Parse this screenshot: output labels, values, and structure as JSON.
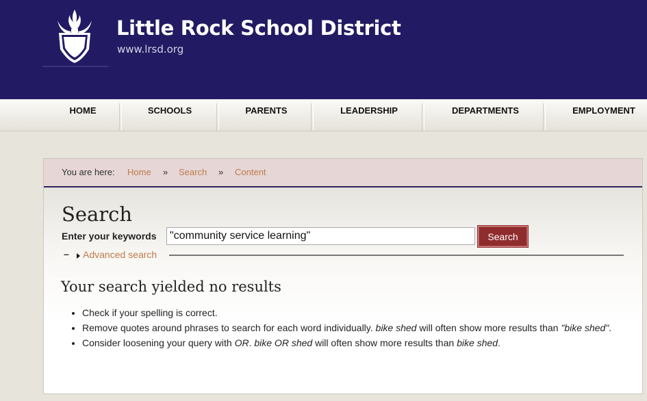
{
  "header": {
    "site_name": "Little Rock School District",
    "site_url": "www.lrsd.org",
    "logo_icon": "torch-shield-logo-icon",
    "background": "#221b63"
  },
  "nav": {
    "items": [
      {
        "label": "HOME"
      },
      {
        "label": "SCHOOLS"
      },
      {
        "label": "PARENTS"
      },
      {
        "label": "LEADERSHIP"
      },
      {
        "label": "DEPARTMENTS"
      },
      {
        "label": "EMPLOYMENT"
      }
    ]
  },
  "breadcrumb": {
    "prefix": "You are here:",
    "separator": "»",
    "items": [
      "Home",
      "Search",
      "Content"
    ]
  },
  "search": {
    "title": "Search",
    "keywords_label": "Enter your keywords",
    "keywords_value": "\"community service learning\"",
    "button_label": "Search",
    "button_color": "#8f2c2d",
    "advanced_toggle": "–",
    "advanced_label": "Advanced search",
    "link_color": "#bf7a4a"
  },
  "results": {
    "heading": "Your search yielded no results",
    "tips": [
      {
        "plain": "Check if your spelling is correct."
      },
      {
        "text1": "Remove quotes around phrases to search for each word individually. ",
        "em1": "bike shed",
        "text2": " will often show more results than ",
        "em2": "\"bike shed\"",
        "text3": "."
      },
      {
        "text1": "Consider loosening your query with ",
        "em1": "OR",
        "text2": ". ",
        "em2": "bike OR shed",
        "text3": " will often show more results than ",
        "em3": "bike shed",
        "text4": "."
      }
    ]
  }
}
